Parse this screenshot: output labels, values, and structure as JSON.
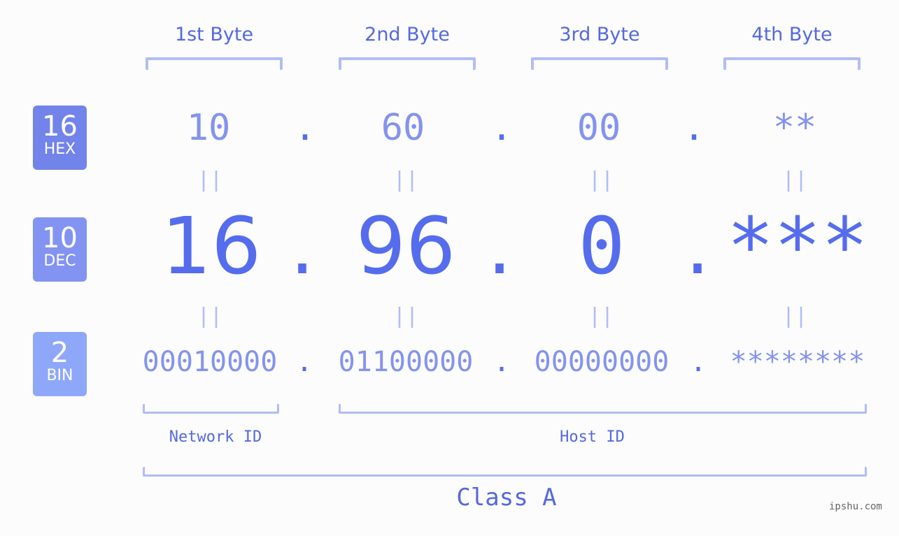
{
  "headers": [
    "1st Byte",
    "2nd Byte",
    "3rd Byte",
    "4th Byte"
  ],
  "badges": {
    "hex": {
      "num": "16",
      "label": "HEX"
    },
    "dec": {
      "num": "10",
      "label": "DEC"
    },
    "bin": {
      "num": "2",
      "label": "BIN"
    }
  },
  "hex": [
    "10",
    "60",
    "00",
    "**"
  ],
  "dec": [
    "16",
    "96",
    "0",
    "***"
  ],
  "bin": [
    "00010000",
    "01100000",
    "00000000",
    "********"
  ],
  "separator": ".",
  "equals": "||",
  "network_label": "Network ID",
  "host_label": "Host ID",
  "class_label": "Class A",
  "watermark": "ipshu.com",
  "colors": {
    "accent": "#556ced",
    "light_accent": "#8493ee",
    "bracket": "#b2bcf6",
    "hex_badge": "#7283ea",
    "dec_badge": "#8393f2",
    "bin_badge": "#8ea7f9"
  }
}
